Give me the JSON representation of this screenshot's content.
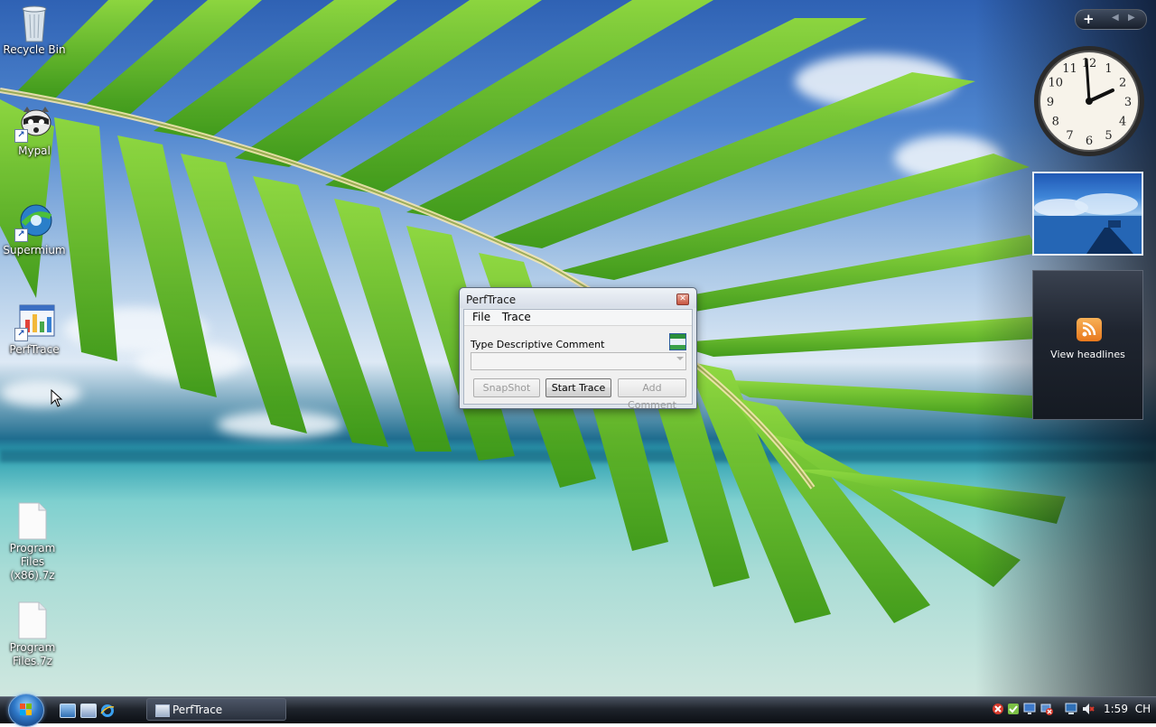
{
  "desktop_icons": [
    {
      "label": "Recycle Bin"
    },
    {
      "label": "Mypal"
    },
    {
      "label": "Supermium"
    },
    {
      "label": "PerfTrace"
    },
    {
      "label": "Program Files (x86).7z"
    },
    {
      "label": "Program Files.7z"
    }
  ],
  "window": {
    "title": "PerfTrace",
    "close_glyph": "✕",
    "menu": [
      "File",
      "Trace"
    ],
    "comment_label": "Type Descriptive Comment",
    "comment_value": "",
    "buttons": {
      "snapshot": "SnapShot",
      "start_trace": "Start Trace",
      "add_comment": "Add Comment"
    }
  },
  "sidebar": {
    "add_glyph": "+",
    "clock": {
      "numerals": [
        "12",
        "1",
        "2",
        "3",
        "4",
        "5",
        "6",
        "7",
        "8",
        "9",
        "10",
        "11"
      ],
      "time": "1:59"
    },
    "feed": {
      "label": "View headlines"
    }
  },
  "taskbar": {
    "tasks": [
      {
        "label": "PerfTrace"
      }
    ],
    "clock": "1:59",
    "language": "CH"
  },
  "colors": {
    "sky": "#2f62b4",
    "sea": "#7fd0cf",
    "palm": "#4fae1a",
    "taskbar": "#1f242c"
  }
}
